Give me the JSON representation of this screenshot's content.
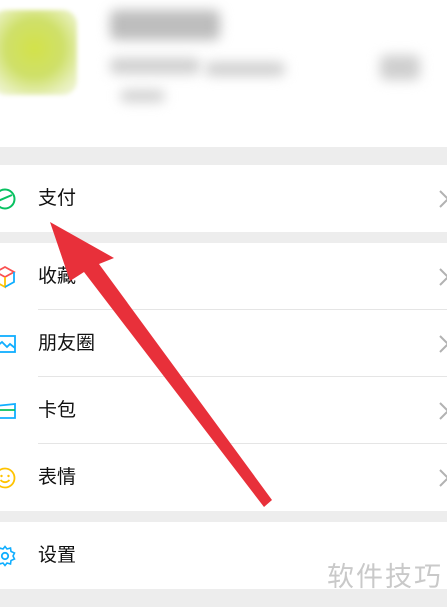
{
  "menu": {
    "pay": {
      "label": "支付",
      "icon": "pay-icon"
    },
    "favorites": {
      "label": "收藏",
      "icon": "favorites-cube-icon"
    },
    "moments": {
      "label": "朋友圈",
      "icon": "moments-photo-icon"
    },
    "cards": {
      "label": "卡包",
      "icon": "card-wallet-icon"
    },
    "stickers": {
      "label": "表情",
      "icon": "smiley-icon"
    },
    "settings": {
      "label": "设置",
      "icon": "gear-icon"
    }
  },
  "watermark": "软件技巧",
  "colors": {
    "accent_green": "#07c160",
    "arrow_red": "#e8303a",
    "background": "#ededed"
  }
}
